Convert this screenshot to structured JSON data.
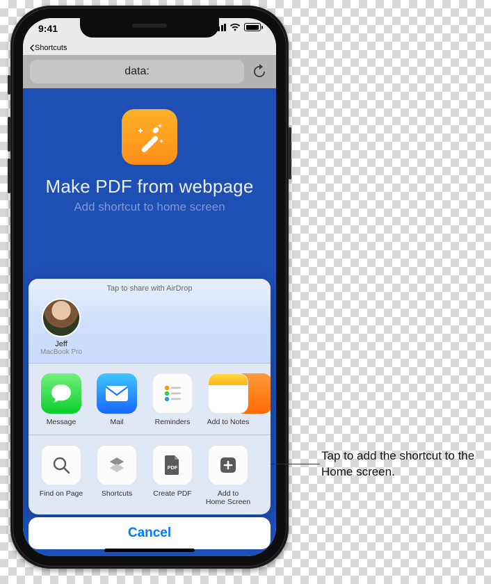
{
  "status": {
    "time": "9:41"
  },
  "breadcrumb": {
    "label": "Shortcuts"
  },
  "url_bar": {
    "text": "data:"
  },
  "page": {
    "title": "Make PDF from webpage",
    "subtitle": "Add shortcut to home screen"
  },
  "share": {
    "airdrop_header": "Tap to share with AirDrop",
    "contact": {
      "name": "Jeff",
      "device": "MacBook Pro"
    },
    "apps": [
      {
        "label": "Message"
      },
      {
        "label": "Mail"
      },
      {
        "label": "Reminders"
      },
      {
        "label": "Add to Notes"
      }
    ],
    "actions": [
      {
        "label": "Find on Page"
      },
      {
        "label": "Shortcuts"
      },
      {
        "label": "Create PDF"
      },
      {
        "label": "Add to\nHome Screen"
      }
    ],
    "cancel": "Cancel"
  },
  "callout": {
    "text": "Tap to add the shortcut to the Home screen."
  }
}
